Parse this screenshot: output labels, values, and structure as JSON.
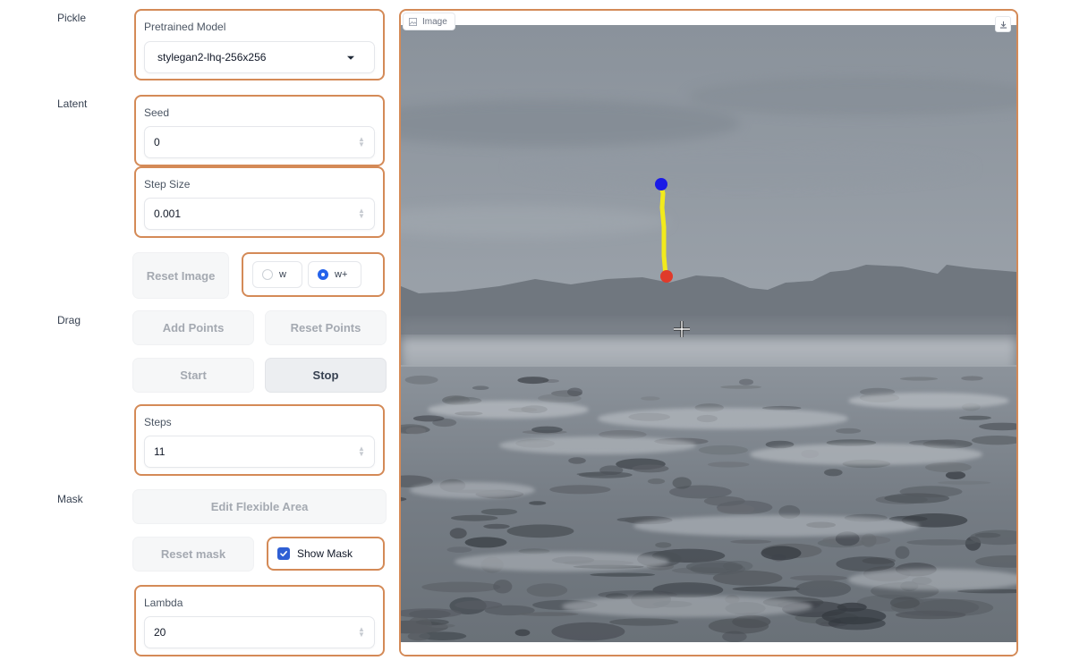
{
  "sections": {
    "pickle": "Pickle",
    "latent": "Latent",
    "drag": "Drag",
    "mask": "Mask"
  },
  "pretrained_model": {
    "label": "Pretrained Model",
    "value": "stylegan2-lhq-256x256"
  },
  "seed": {
    "label": "Seed",
    "value": "0"
  },
  "step_size": {
    "label": "Step Size",
    "value": "0.001"
  },
  "buttons": {
    "reset_image": "Reset Image",
    "add_points": "Add Points",
    "reset_points": "Reset Points",
    "start": "Start",
    "stop": "Stop",
    "edit_flexible_area": "Edit Flexible Area",
    "reset_mask": "Reset mask"
  },
  "latent_space": {
    "options": [
      "w",
      "w+"
    ],
    "selected": "w+"
  },
  "steps": {
    "label": "Steps",
    "value": "11"
  },
  "show_mask": {
    "label": "Show Mask",
    "checked": true
  },
  "lambda": {
    "label": "Lambda",
    "value": "20"
  },
  "image": {
    "tag": "Image",
    "handle_point_color": "#1a1ae6",
    "target_point_color": "#e03a2a",
    "drag_line_color": "#f2ea1c"
  }
}
